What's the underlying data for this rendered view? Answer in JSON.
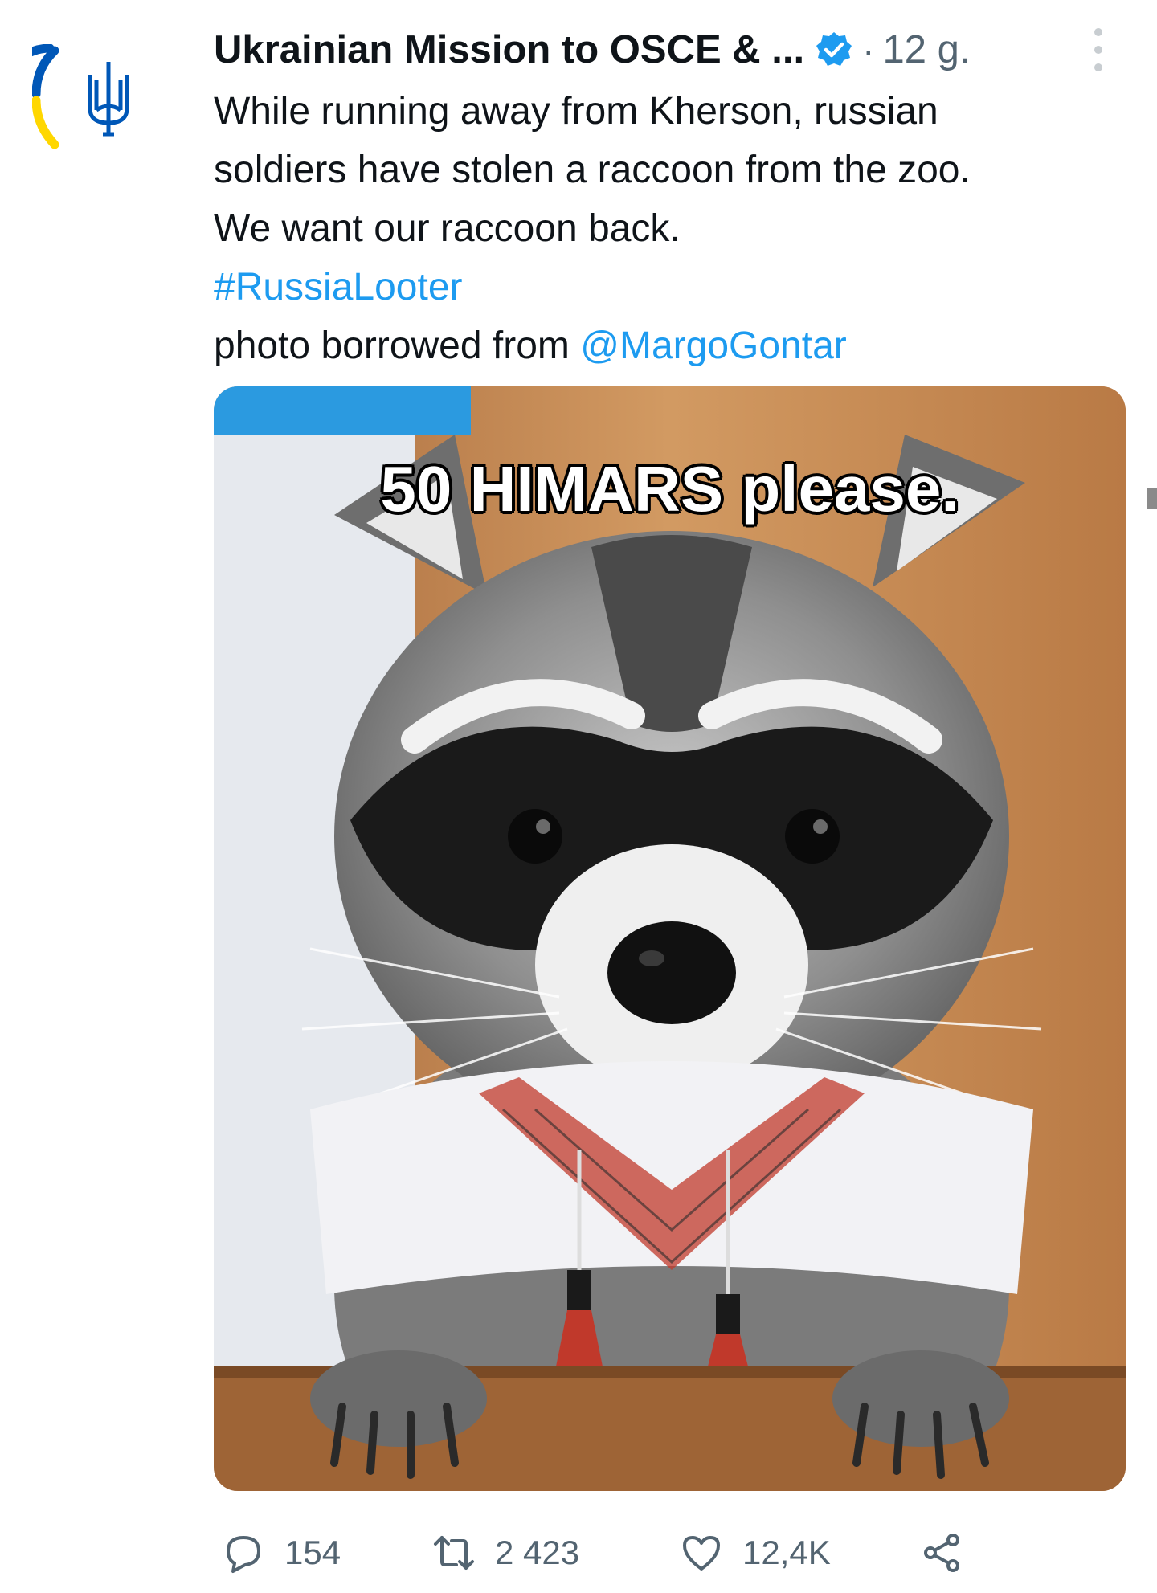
{
  "tweet": {
    "author": "Ukrainian Mission to OSCE & ...",
    "time": "12 g.",
    "separator": "·",
    "lines": [
      "While running away from Kherson, russian",
      "soldiers have stolen a raccoon from the zoo.",
      "We want our raccoon back."
    ],
    "hashtag": "#RussiaLooter",
    "credit_prefix": "photo borrowed from ",
    "mention": "@MargoGontar",
    "image_caption": "50 HIMARS please."
  },
  "actions": {
    "replies": "154",
    "retweets": "2 423",
    "likes": "12,4K"
  },
  "colors": {
    "accent": "#1d9bf0",
    "secondary": "#536471",
    "ukraine_blue": "#0057b7",
    "ukraine_yellow": "#ffd700"
  },
  "icons": [
    "ukraine-trident-icon",
    "verified-badge-icon",
    "more-options-icon",
    "reply-icon",
    "retweet-icon",
    "like-icon",
    "share-icon"
  ]
}
